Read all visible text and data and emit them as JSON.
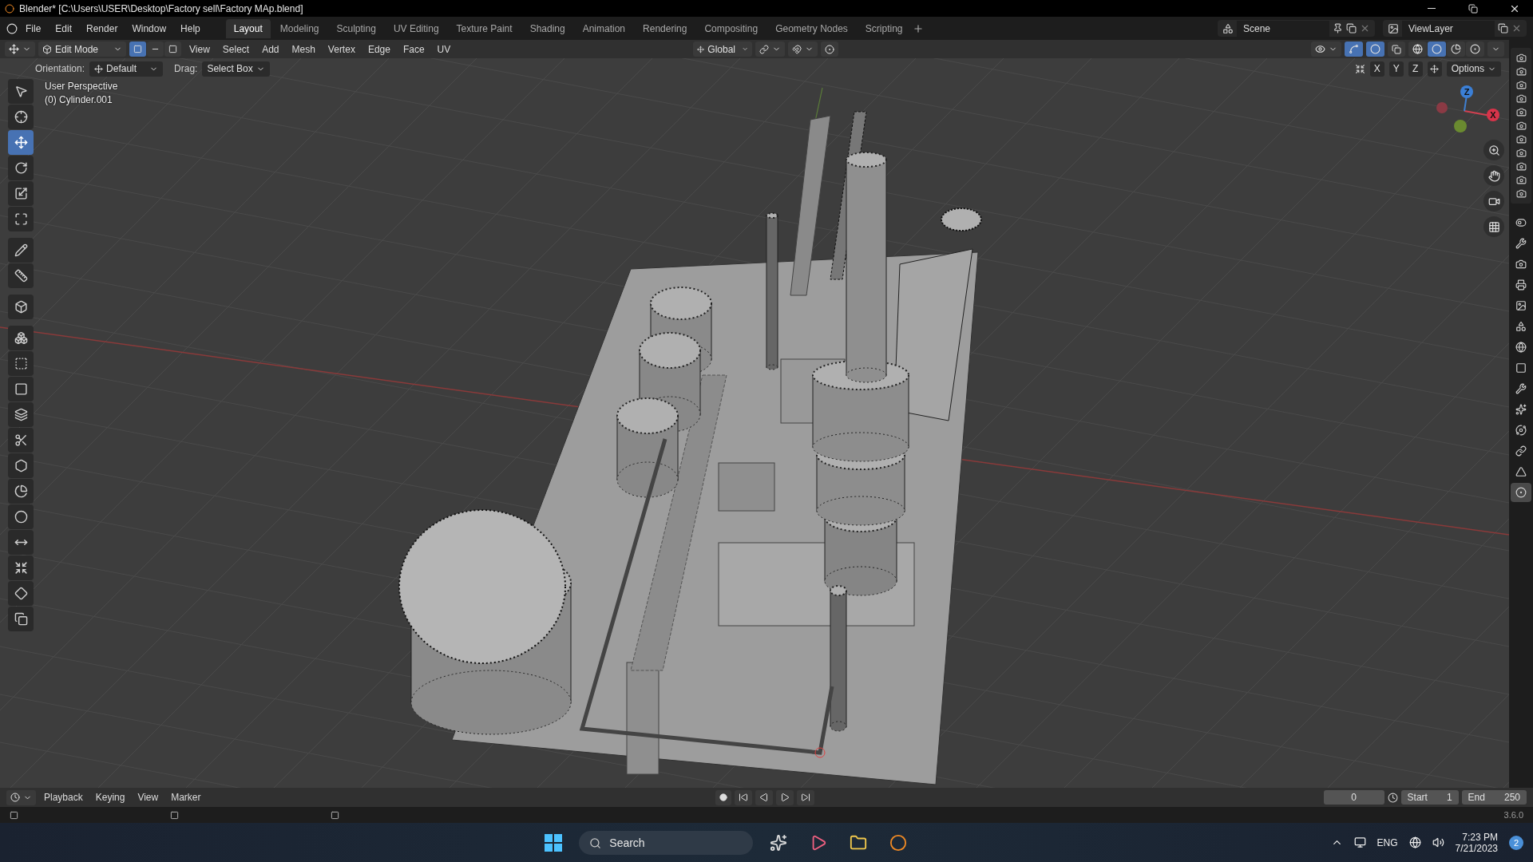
{
  "title_bar": {
    "title": "Blender* [C:\\Users\\USER\\Desktop\\Factory sell\\Factory MAp.blend]"
  },
  "menu": [
    "File",
    "Edit",
    "Render",
    "Window",
    "Help"
  ],
  "workspaces": [
    {
      "label": "Layout",
      "selected": true
    },
    {
      "label": "Modeling",
      "selected": false
    },
    {
      "label": "Sculpting",
      "selected": false
    },
    {
      "label": "UV Editing",
      "selected": false
    },
    {
      "label": "Texture Paint",
      "selected": false
    },
    {
      "label": "Shading",
      "selected": false
    },
    {
      "label": "Animation",
      "selected": false
    },
    {
      "label": "Rendering",
      "selected": false
    },
    {
      "label": "Compositing",
      "selected": false
    },
    {
      "label": "Geometry Nodes",
      "selected": false
    },
    {
      "label": "Scripting",
      "selected": false
    }
  ],
  "scene": {
    "name": "Scene"
  },
  "view_layer": {
    "name": "ViewLayer"
  },
  "header": {
    "mode": "Edit Mode",
    "select_modes": [
      {
        "selected": true
      },
      {
        "selected": false
      },
      {
        "selected": false
      }
    ],
    "menus": [
      "View",
      "Select",
      "Add",
      "Mesh",
      "Vertex",
      "Edge",
      "Face",
      "UV"
    ],
    "orientation": "Global",
    "shading_modes": [
      {
        "selected": false
      },
      {
        "selected": true
      },
      {
        "selected": false
      },
      {
        "selected": false
      }
    ]
  },
  "tool_settings": {
    "orientation_label": "Orientation:",
    "orientation": "Default",
    "drag_label": "Drag:",
    "drag": "Select Box",
    "mirror_axes": [
      "X",
      "Y",
      "Z"
    ],
    "options": "Options"
  },
  "viewport": {
    "info": [
      "User Perspective",
      "(0) Cylinder.001"
    ],
    "gizmo_axes": [
      "Z",
      "X"
    ]
  },
  "toolbar": [
    {
      "selected": false
    },
    {
      "selected": false
    },
    {
      "selected": true
    },
    {
      "selected": false
    },
    {
      "selected": false
    },
    {
      "selected": false
    },
    {
      "selected": false
    },
    {
      "selected": false
    },
    {
      "selected": false
    },
    {
      "selected": false
    },
    {
      "selected": false
    },
    {
      "selected": false
    },
    {
      "selected": false
    },
    {
      "selected": false
    },
    {
      "selected": false
    },
    {
      "selected": false
    },
    {
      "selected": false
    },
    {
      "selected": false
    },
    {
      "selected": false
    },
    {
      "selected": false
    },
    {
      "selected": false
    }
  ],
  "properties_tabs": [
    {
      "selected": false
    },
    {
      "selected": false
    },
    {
      "selected": false
    },
    {
      "selected": false
    },
    {
      "selected": false
    },
    {
      "selected": false
    },
    {
      "selected": false
    },
    {
      "selected": false
    },
    {
      "selected": false
    },
    {
      "selected": false
    },
    {
      "selected": false
    },
    {
      "selected": false
    },
    {
      "selected": false
    },
    {
      "selected": true
    }
  ],
  "timeline": {
    "menus": [
      "Playback",
      "Keying",
      "View",
      "Marker"
    ],
    "current_frame": "0",
    "start_label": "Start",
    "start": "1",
    "end_label": "End",
    "end": "250"
  },
  "status_bar": {
    "version": "3.6.0"
  },
  "taskbar": {
    "search_placeholder": "Search",
    "language": "ENG",
    "time": "7:23 PM",
    "date": "7/21/2023",
    "notifications": "2"
  }
}
